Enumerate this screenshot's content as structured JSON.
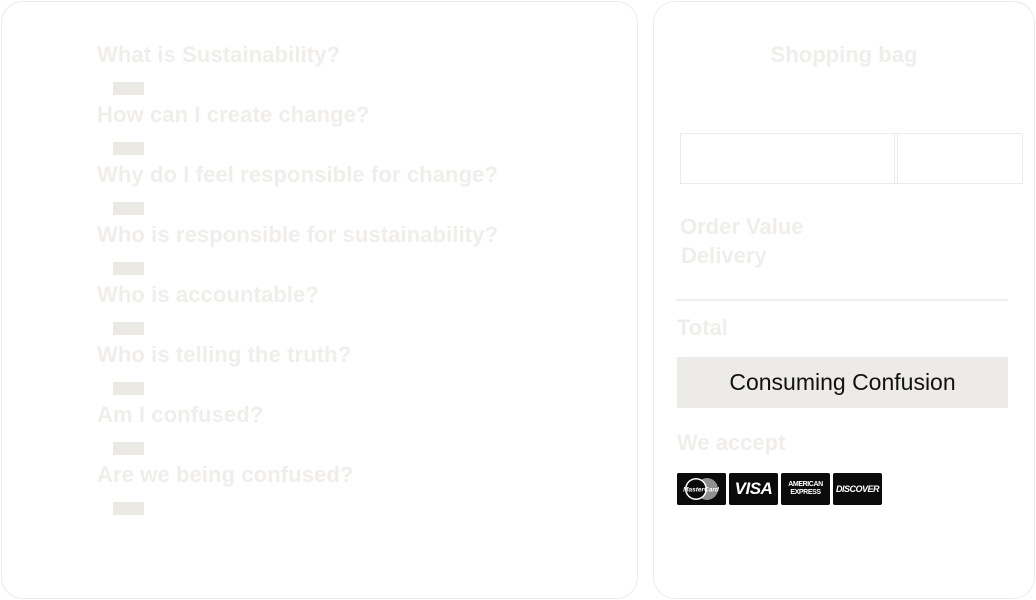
{
  "questions": [
    "What is Sustainability?",
    "How can I create change?",
    "Why do I feel responsible for change?",
    "Who is responsible for sustainability?",
    "Who is accountable?",
    "Who is telling the truth?",
    "Am I confused?",
    "Are we being confused?"
  ],
  "bag": {
    "title": "Shopping bag",
    "order_value_label": "Order Value",
    "delivery_label": "Delivery",
    "total_label": "Total",
    "cta_label": "Consuming Confusion",
    "we_accept_label": "We accept"
  },
  "payment_cards": [
    {
      "name": "mastercard-icon",
      "text": "MasterCard"
    },
    {
      "name": "visa-icon",
      "text": "VISA"
    },
    {
      "name": "american-express-icon",
      "text": "AMERICAN EXPRESS"
    },
    {
      "name": "discover-icon",
      "text": "DISCOVER"
    }
  ],
  "colors": {
    "faded_text": "#efeeea",
    "placeholder_bar": "#ebe9e4",
    "button_bg": "#ecebe7",
    "button_text": "#111111"
  }
}
